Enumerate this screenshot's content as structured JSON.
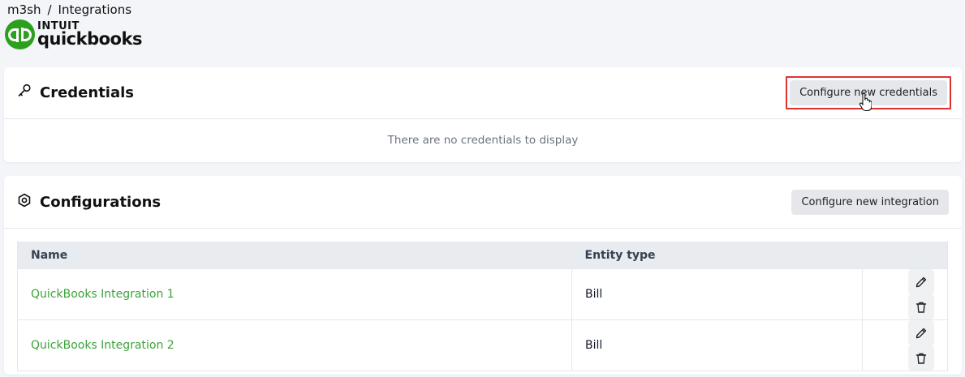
{
  "breadcrumb": {
    "org": "m3sh",
    "separator": "/",
    "current": "Integrations"
  },
  "logo": {
    "intuit": "INTUIT",
    "name": "quickbooks",
    "brand_color": "#2ca01c"
  },
  "credentials": {
    "title": "Credentials",
    "configure_button": "Configure new credentials",
    "empty_message": "There are no credentials to display"
  },
  "configurations": {
    "title": "Configurations",
    "configure_button": "Configure new integration",
    "columns": {
      "name": "Name",
      "entity_type": "Entity type"
    },
    "rows": [
      {
        "name": "QuickBooks Integration 1",
        "entity_type": "Bill"
      },
      {
        "name": "QuickBooks Integration 2",
        "entity_type": "Bill"
      }
    ]
  },
  "colors": {
    "link": "#3aa33a",
    "highlight": "#e03131"
  }
}
